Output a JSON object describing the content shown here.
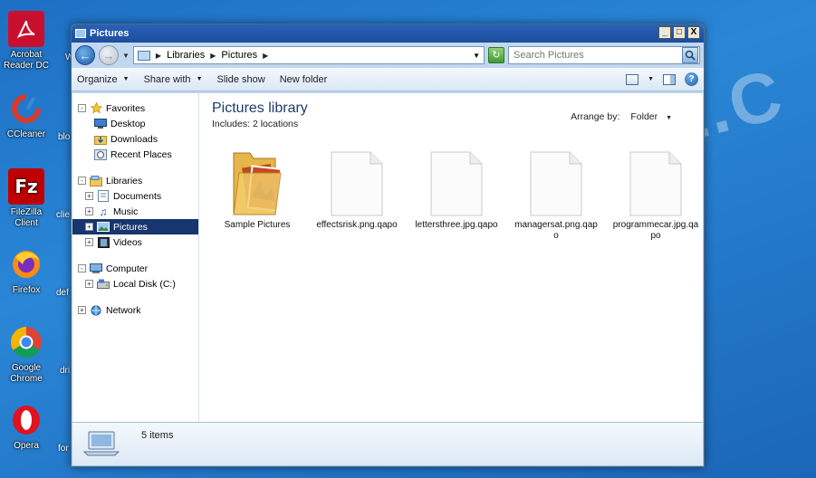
{
  "desktop": {
    "icons": [
      {
        "label": "Acrobat Reader DC"
      },
      {
        "label": "CCleaner"
      },
      {
        "label": "FileZilla Client"
      },
      {
        "label": "Firefox"
      },
      {
        "label": "Google Chrome"
      },
      {
        "label": "Opera"
      }
    ],
    "partial_labels": [
      "W",
      "blo",
      "clie",
      "def",
      "dri",
      "for"
    ],
    "watermark": "ANTISPYWARE.C"
  },
  "window": {
    "title": "Pictures",
    "buttons": {
      "minimize": "_",
      "maximize": "□",
      "close": "X"
    },
    "address": {
      "crumbs": [
        "Libraries",
        "Pictures"
      ]
    },
    "search": {
      "placeholder": "Search Pictures"
    },
    "toolbar": {
      "organize": "Organize",
      "share_with": "Share with",
      "slide_show": "Slide show",
      "new_folder": "New folder"
    },
    "nav": {
      "favorites": "Favorites",
      "desktop": "Desktop",
      "downloads": "Downloads",
      "recent_places": "Recent Places",
      "libraries": "Libraries",
      "documents": "Documents",
      "music": "Music",
      "pictures": "Pictures",
      "videos": "Videos",
      "computer": "Computer",
      "local_disk": "Local Disk (C:)",
      "network": "Network"
    },
    "content": {
      "title": "Pictures library",
      "includes": "Includes:  2 locations",
      "arrange_by_label": "Arrange by:",
      "arrange_by_value": "Folder",
      "files": [
        {
          "name": "Sample Pictures",
          "kind": "folder"
        },
        {
          "name": "effectsrisk.png.qapo",
          "kind": "file"
        },
        {
          "name": "lettersthree.jpg.qapo",
          "kind": "file"
        },
        {
          "name": "managersat.png.qapo",
          "kind": "file"
        },
        {
          "name": "programmecar.jpg.qapo",
          "kind": "file"
        }
      ]
    },
    "status": {
      "items": "5 items"
    }
  },
  "colors": {
    "selection": "#17356e",
    "titlebar": "#2a62b8",
    "desktop": "#1d6fc4"
  }
}
